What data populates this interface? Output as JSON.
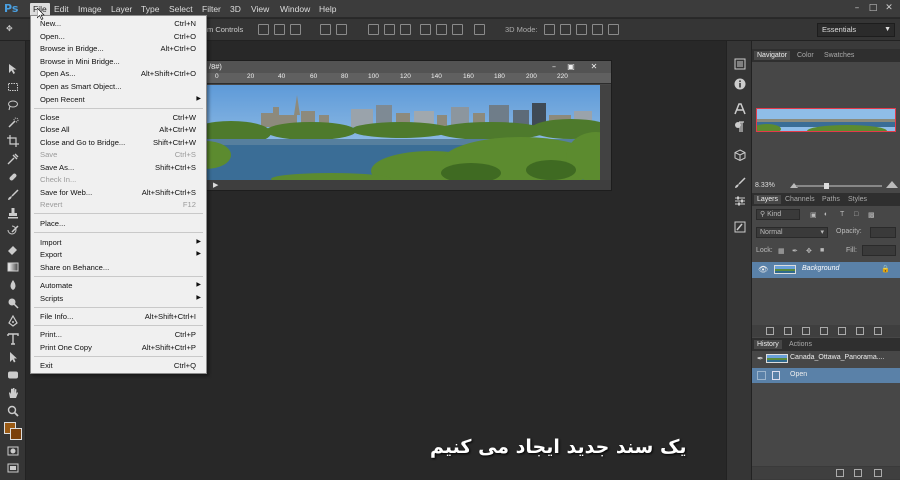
{
  "app": {
    "logo": "Ps"
  },
  "menubar": {
    "items": [
      "File",
      "Edit",
      "Image",
      "Layer",
      "Type",
      "Select",
      "Filter",
      "3D",
      "View",
      "Window",
      "Help"
    ],
    "active": "File"
  },
  "optionsbar": {
    "controls_label": "m Controls",
    "mode3d_label": "3D Mode:",
    "workspace": "Essentials"
  },
  "document": {
    "title": "/8#)",
    "ruler_ticks": [
      "0",
      "20",
      "40",
      "60",
      "80",
      "100",
      "120",
      "140",
      "160",
      "180",
      "200",
      "220"
    ]
  },
  "file_menu": {
    "items": [
      {
        "label": "New...",
        "shortcut": "Ctrl+N",
        "enabled": true
      },
      {
        "label": "Open...",
        "shortcut": "Ctrl+O",
        "enabled": true
      },
      {
        "label": "Browse in Bridge...",
        "shortcut": "Alt+Ctrl+O",
        "enabled": true
      },
      {
        "label": "Browse in Mini Bridge...",
        "shortcut": "",
        "enabled": true
      },
      {
        "label": "Open As...",
        "shortcut": "Alt+Shift+Ctrl+O",
        "enabled": true
      },
      {
        "label": "Open as Smart Object...",
        "shortcut": "",
        "enabled": true
      },
      {
        "label": "Open Recent",
        "shortcut": "",
        "enabled": true,
        "submenu": true
      },
      {
        "label": "Close",
        "shortcut": "Ctrl+W",
        "enabled": true
      },
      {
        "label": "Close All",
        "shortcut": "Alt+Ctrl+W",
        "enabled": true
      },
      {
        "label": "Close and Go to Bridge...",
        "shortcut": "Shift+Ctrl+W",
        "enabled": true
      },
      {
        "label": "Save",
        "shortcut": "Ctrl+S",
        "enabled": false
      },
      {
        "label": "Save As...",
        "shortcut": "Shift+Ctrl+S",
        "enabled": true
      },
      {
        "label": "Check In...",
        "shortcut": "",
        "enabled": false
      },
      {
        "label": "Save for Web...",
        "shortcut": "Alt+Shift+Ctrl+S",
        "enabled": true
      },
      {
        "label": "Revert",
        "shortcut": "F12",
        "enabled": false
      },
      {
        "label": "Place...",
        "shortcut": "",
        "enabled": true
      },
      {
        "label": "Import",
        "shortcut": "",
        "enabled": true,
        "submenu": true
      },
      {
        "label": "Export",
        "shortcut": "",
        "enabled": true,
        "submenu": true
      },
      {
        "label": "Share on Behance...",
        "shortcut": "",
        "enabled": true
      },
      {
        "label": "Automate",
        "shortcut": "",
        "enabled": true,
        "submenu": true
      },
      {
        "label": "Scripts",
        "shortcut": "",
        "enabled": true,
        "submenu": true
      },
      {
        "label": "File Info...",
        "shortcut": "Alt+Shift+Ctrl+I",
        "enabled": true
      },
      {
        "label": "Print...",
        "shortcut": "Ctrl+P",
        "enabled": true
      },
      {
        "label": "Print One Copy",
        "shortcut": "Alt+Shift+Ctrl+P",
        "enabled": true
      },
      {
        "label": "Exit",
        "shortcut": "Ctrl+Q",
        "enabled": true
      }
    ]
  },
  "navigator": {
    "tabs": [
      "Navigator",
      "Color",
      "Swatches"
    ],
    "zoom": "8.33%"
  },
  "layers": {
    "tabs": [
      "Layers",
      "Channels",
      "Paths",
      "Styles"
    ],
    "filter_kind": "Kind",
    "blend_mode": "Normal",
    "opacity_label": "Opacity:",
    "lock_label": "Lock:",
    "fill_label": "Fill:",
    "layer_name": "Background"
  },
  "history": {
    "tabs": [
      "History",
      "Actions"
    ],
    "snapshot": "Canada_Ottawa_Panorama....",
    "steps": [
      "Open"
    ]
  },
  "subtitle": "یک سند جدید ایجاد می کنیم",
  "colors": {
    "foreground": "#9a5a14",
    "background": "#7a3f0a",
    "layer_highlight": "#5a81a8",
    "nav_frame": "#e43a4a"
  }
}
